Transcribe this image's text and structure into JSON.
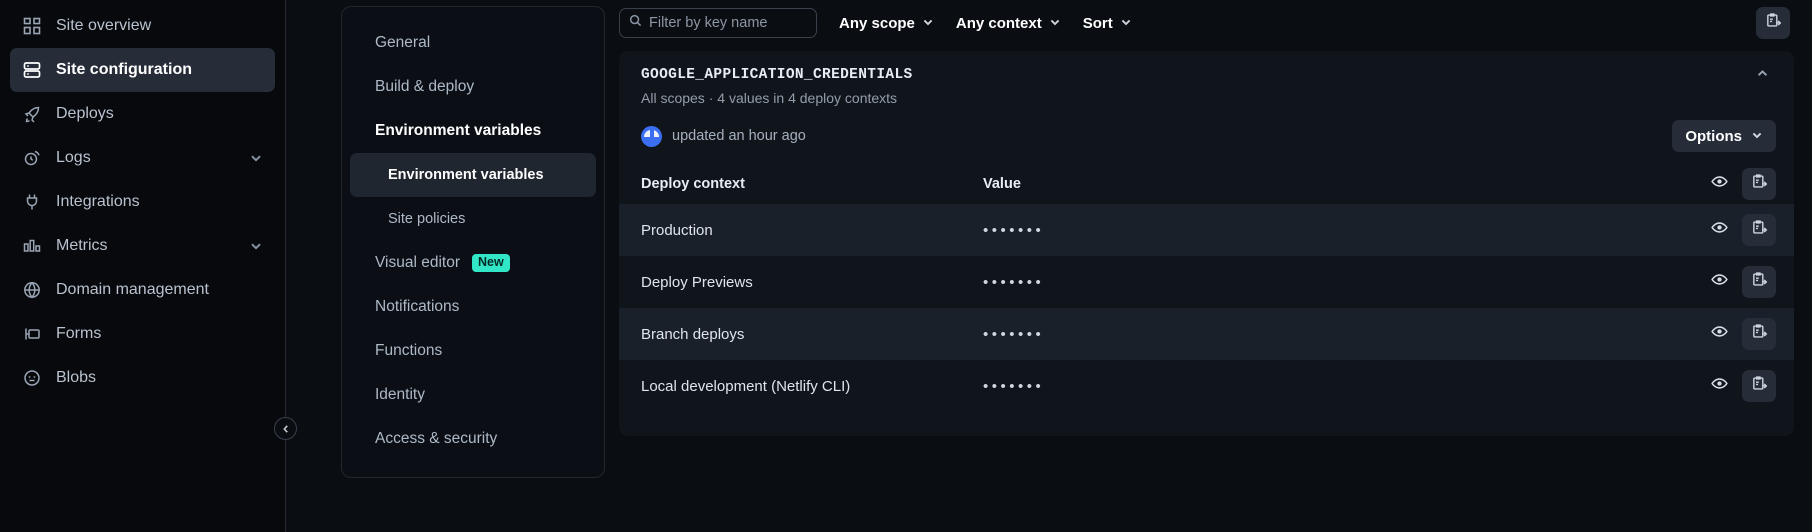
{
  "sidebar": {
    "items": [
      {
        "label": "Site overview",
        "icon": "grid-icon",
        "active": false,
        "caret": false
      },
      {
        "label": "Site configuration",
        "icon": "server-icon",
        "active": true,
        "caret": false
      },
      {
        "label": "Deploys",
        "icon": "rocket-icon",
        "active": false,
        "caret": false
      },
      {
        "label": "Logs",
        "icon": "logs-icon",
        "active": false,
        "caret": true
      },
      {
        "label": "Integrations",
        "icon": "plug-icon",
        "active": false,
        "caret": false
      },
      {
        "label": "Metrics",
        "icon": "bar-chart-icon",
        "active": false,
        "caret": true
      },
      {
        "label": "Domain management",
        "icon": "globe-icon",
        "active": false,
        "caret": false
      },
      {
        "label": "Forms",
        "icon": "form-icon",
        "active": false,
        "caret": false
      },
      {
        "label": "Blobs",
        "icon": "blob-icon",
        "active": false,
        "caret": false
      }
    ],
    "collapse_handle_icon": "chevron-left-icon"
  },
  "subnav": {
    "items": [
      {
        "label": "General",
        "level": "parent",
        "active": false,
        "badge": null
      },
      {
        "label": "Build & deploy",
        "level": "parent",
        "active": false,
        "badge": null
      },
      {
        "label": "Environment variables",
        "level": "parent",
        "active": true,
        "badge": null
      },
      {
        "label": "Environment variables",
        "level": "child",
        "active": true,
        "badge": null
      },
      {
        "label": "Site policies",
        "level": "child",
        "active": false,
        "badge": null
      },
      {
        "label": "Visual editor",
        "level": "parent",
        "active": false,
        "badge": "New"
      },
      {
        "label": "Notifications",
        "level": "parent",
        "active": false,
        "badge": null
      },
      {
        "label": "Functions",
        "level": "parent",
        "active": false,
        "badge": null
      },
      {
        "label": "Identity",
        "level": "parent",
        "active": false,
        "badge": null
      },
      {
        "label": "Access & security",
        "level": "parent",
        "active": false,
        "badge": null
      }
    ]
  },
  "toolbar": {
    "search_placeholder": "Filter by key name",
    "search_value": "",
    "search_icon": "search-icon",
    "scope_filter": "Any scope",
    "context_filter": "Any context",
    "sort_label": "Sort",
    "import_icon": "clipboard-import-icon"
  },
  "variable": {
    "key_name": "GOOGLE_APPLICATION_CREDENTIALS",
    "scope_text": "All scopes",
    "separator": "·",
    "values_text": "4 values in 4 deploy contexts",
    "updated_text": "updated an hour ago",
    "options_label": "Options",
    "collapse_icon": "chevron-up-icon",
    "avatar_name": "user-avatar"
  },
  "table": {
    "headers": {
      "context": "Deploy context",
      "value": "Value"
    },
    "header_actions": {
      "reveal_icon": "eye-icon",
      "copy_icon": "clipboard-import-icon"
    },
    "rows": [
      {
        "context": "Production",
        "value": "•••••••"
      },
      {
        "context": "Deploy Previews",
        "value": "•••••••"
      },
      {
        "context": "Branch deploys",
        "value": "•••••••"
      },
      {
        "context": "Local development (Netlify CLI)",
        "value": "•••••••"
      }
    ]
  },
  "colors": {
    "accent_badge": "#32e6c8",
    "avatar": "#3b6ef0",
    "panel": "#10151c",
    "row_alt": "#1a202a"
  }
}
